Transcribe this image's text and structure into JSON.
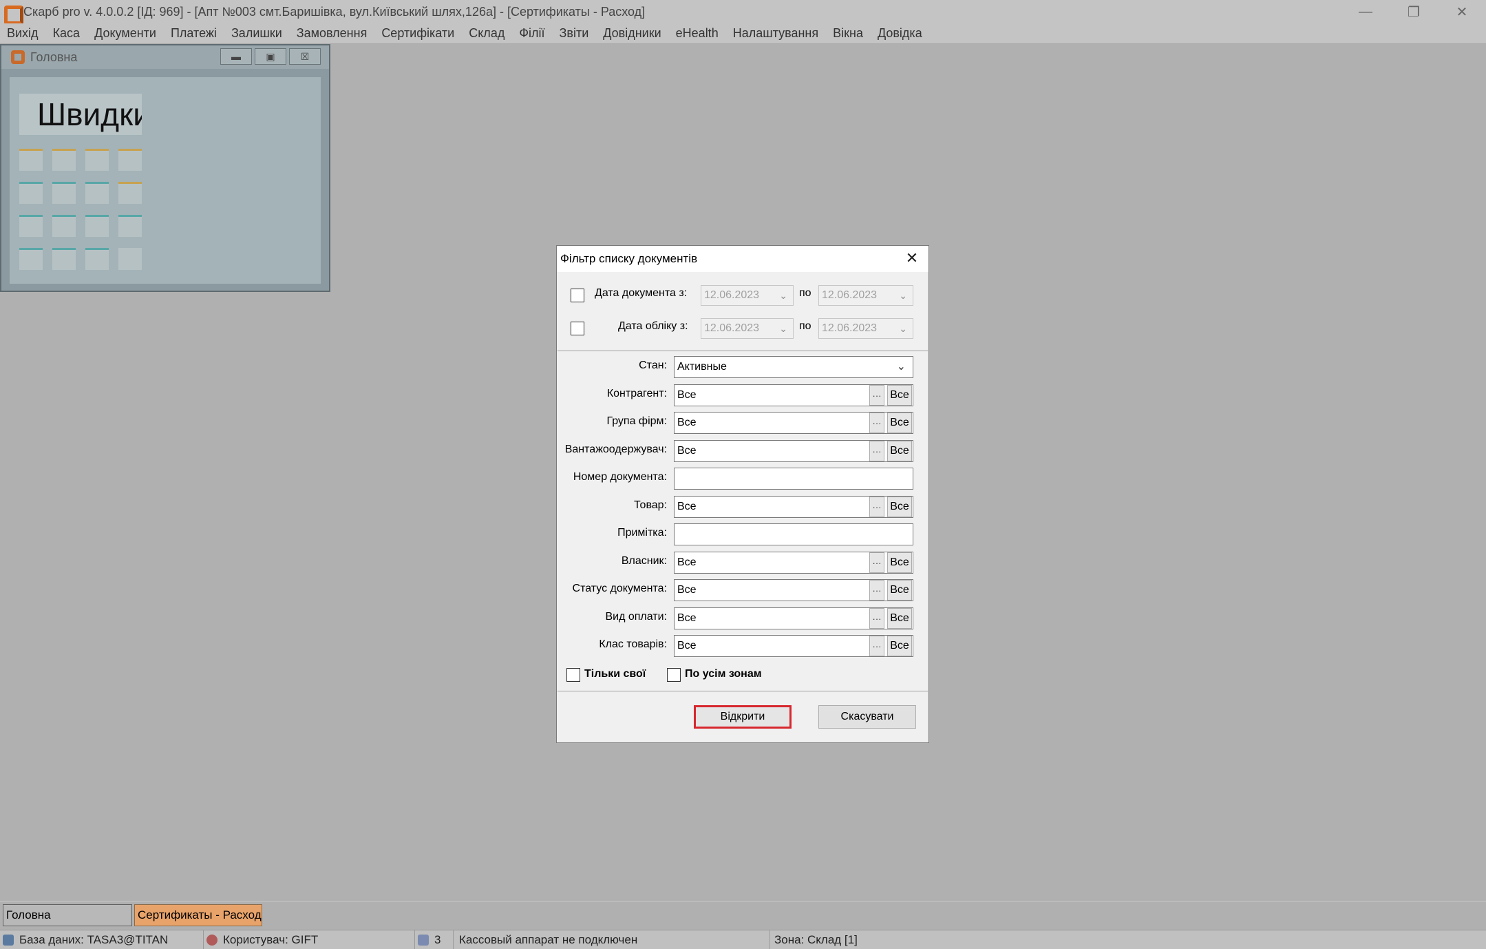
{
  "window": {
    "title": "Скарб pro v. 4.0.0.2 [ІД: 969] - [Апт №003 смт.Баришівка, вул.Київський шлях,126а] - [Сертификаты - Расход]"
  },
  "menu": {
    "items": [
      {
        "label": "Вихід"
      },
      {
        "label": "Каса"
      },
      {
        "label": "Документи"
      },
      {
        "label": "Платежі"
      },
      {
        "label": "Залишки"
      },
      {
        "label": "Замовлення"
      },
      {
        "label": "Сертифікати"
      },
      {
        "label": "Склад"
      },
      {
        "label": "Філії"
      },
      {
        "label": "Звіти"
      },
      {
        "label": "Довідники"
      },
      {
        "label": "eHealth"
      },
      {
        "label": "Налаштування"
      },
      {
        "label": "Вікна"
      },
      {
        "label": "Довідка"
      }
    ]
  },
  "main_window": {
    "title": "Головна",
    "quick_title": "Швидкий"
  },
  "dialog": {
    "title": "Фільтр списку документів",
    "date_doc_label": "Дата документа з:",
    "date_account_label": "Дата обліку з:",
    "to_label": "по",
    "date_from": "12.06.2023",
    "date_to": "12.06.2023",
    "fields": {
      "state": {
        "label": "Стан:",
        "value": "Активные"
      },
      "counterparty": {
        "label": "Контрагент:",
        "value": "Все"
      },
      "firm_group": {
        "label": "Група фірм:",
        "value": "Все"
      },
      "consignee": {
        "label": "Вантажоодержувач:",
        "value": "Все"
      },
      "doc_number": {
        "label": "Номер документа:",
        "value": ""
      },
      "goods": {
        "label": "Товар:",
        "value": "Все"
      },
      "note": {
        "label": "Примітка:",
        "value": ""
      },
      "owner": {
        "label": "Власник:",
        "value": "Все"
      },
      "doc_status": {
        "label": "Статус документа:",
        "value": "Все"
      },
      "payment_type": {
        "label": "Вид оплати:",
        "value": "Все"
      },
      "goods_class": {
        "label": "Клас товарів:",
        "value": "Все"
      }
    },
    "all_btn": "Все",
    "dots_btn": "···",
    "only_own": "Тільки свої",
    "all_zones": "По усім зонам",
    "open_btn": "Відкрити",
    "cancel_btn": "Скасувати"
  },
  "mdi_tabs": [
    {
      "label": "Головна"
    },
    {
      "label": "Сертификаты - Расход"
    }
  ],
  "status": {
    "database": "База даних: TASA3@TITAN",
    "user": "Користувач: GIFT",
    "count": "3",
    "cash_register": "Кассовый аппарат не подключен",
    "zone": "Зона: Склад [1]"
  },
  "colors": {
    "highlight": "#d7262d",
    "active_tab": "#e8a36a",
    "accent_orange": "#d86a20"
  }
}
